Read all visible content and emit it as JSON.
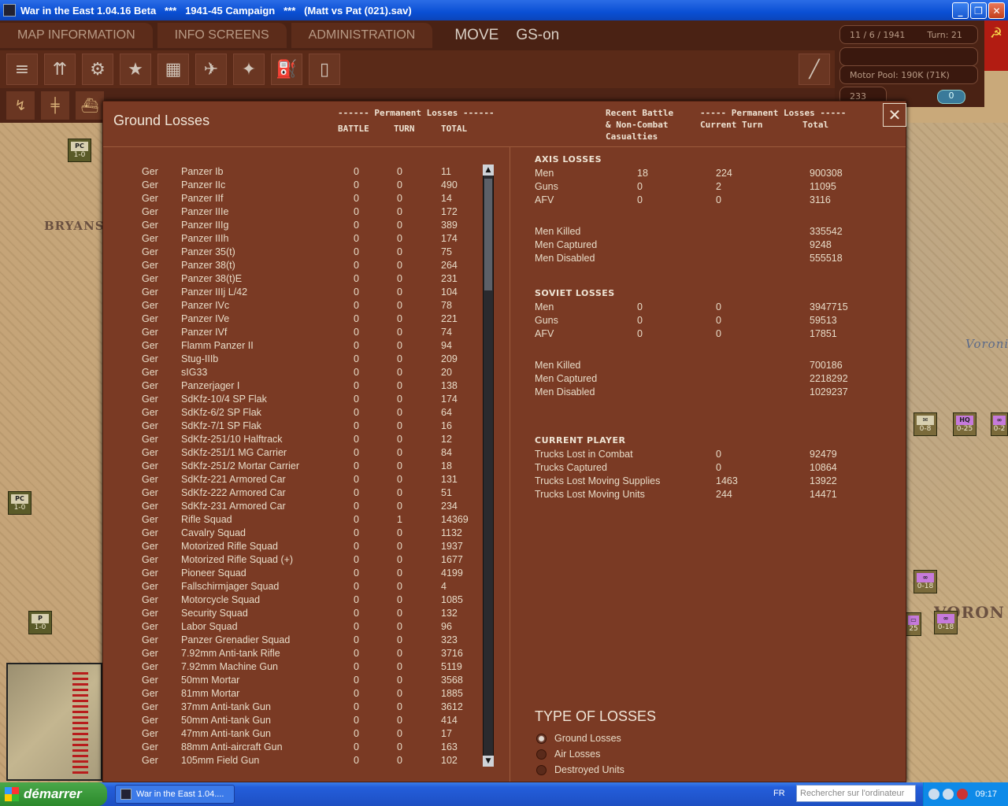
{
  "window": {
    "title": "War in the East 1.04.16 Beta",
    "sep1": "   ***   ",
    "campaign": "1941-45 Campaign",
    "sep2": "   ***   ",
    "save": "(Matt vs Pat (021).sav)",
    "min": "_",
    "max": "❐",
    "close": "✕"
  },
  "menu": {
    "tabs": [
      "MAP INFORMATION",
      "INFO SCREENS",
      "ADMINISTRATION"
    ],
    "mode": "MOVE",
    "gs": "GS-on"
  },
  "info": {
    "date": "11 / 6 / 1941",
    "turn": "Turn: 21",
    "motor_pool": "Motor Pool:  190K (71K)",
    "value": "233",
    "counter": "0"
  },
  "icons": {
    "toolbar": [
      "stack-icon",
      "units-icon",
      "gear-icon",
      "star-icon",
      "city-icon",
      "air-icon",
      "satellite-icon",
      "fuel-icon",
      "rail-icon"
    ],
    "toolbar2": [
      "road-icon",
      "railroad-icon",
      "ship-icon"
    ],
    "pencil": "pencil-icon",
    "flag": "hammer-sickle-icon"
  },
  "map": {
    "labels": [
      "BRYANS",
      "VORON",
      "Voroni"
    ],
    "counters": [
      {
        "type": "PC",
        "strength": "1-0"
      },
      {
        "type": "PC",
        "strength": "1-0"
      },
      {
        "type": "P",
        "strength": "1-0"
      },
      {
        "type": "✉",
        "strength": "0-8"
      },
      {
        "type": "HQ",
        "strength": "0-25"
      },
      {
        "type": "∞",
        "strength": "0-2"
      },
      {
        "type": "∞",
        "strength": "0-18"
      },
      {
        "type": "∞",
        "strength": "0-18"
      },
      {
        "type": "▭",
        "strength": "25"
      }
    ]
  },
  "dialog": {
    "title": "Ground Losses",
    "left_header_group": "------ Permanent Losses ------",
    "col_battle": "BATTLE",
    "col_turn": "TURN",
    "col_total": "TOTAL",
    "recent_line1": "Recent Battle",
    "recent_line2": "& Non-Combat",
    "recent_line3": "Casualties",
    "right_header_group": "----- Permanent Losses -----",
    "col_current": "Current Turn",
    "col_total2": "Total",
    "close": "✕",
    "rows": [
      [
        "Ger",
        "Panzer Ib",
        "0",
        "0",
        "11"
      ],
      [
        "Ger",
        "Panzer IIc",
        "0",
        "0",
        "490"
      ],
      [
        "Ger",
        "Panzer IIf",
        "0",
        "0",
        "14"
      ],
      [
        "Ger",
        "Panzer IIIe",
        "0",
        "0",
        "172"
      ],
      [
        "Ger",
        "Panzer IIIg",
        "0",
        "0",
        "389"
      ],
      [
        "Ger",
        "Panzer IIIh",
        "0",
        "0",
        "174"
      ],
      [
        "Ger",
        "Panzer 35(t)",
        "0",
        "0",
        "75"
      ],
      [
        "Ger",
        "Panzer 38(t)",
        "0",
        "0",
        "264"
      ],
      [
        "Ger",
        "Panzer 38(t)E",
        "0",
        "0",
        "231"
      ],
      [
        "Ger",
        "Panzer IIIj L/42",
        "0",
        "0",
        "104"
      ],
      [
        "Ger",
        "Panzer IVc",
        "0",
        "0",
        "78"
      ],
      [
        "Ger",
        "Panzer IVe",
        "0",
        "0",
        "221"
      ],
      [
        "Ger",
        "Panzer IVf",
        "0",
        "0",
        "74"
      ],
      [
        "Ger",
        "Flamm Panzer II",
        "0",
        "0",
        "94"
      ],
      [
        "Ger",
        "Stug-IIIb",
        "0",
        "0",
        "209"
      ],
      [
        "Ger",
        "sIG33",
        "0",
        "0",
        "20"
      ],
      [
        "Ger",
        "Panzerjager I",
        "0",
        "0",
        "138"
      ],
      [
        "Ger",
        "SdKfz-10/4 SP Flak",
        "0",
        "0",
        "174"
      ],
      [
        "Ger",
        "SdKfz-6/2 SP Flak",
        "0",
        "0",
        "64"
      ],
      [
        "Ger",
        "SdKfz-7/1 SP Flak",
        "0",
        "0",
        "16"
      ],
      [
        "Ger",
        "SdKfz-251/10 Halftrack",
        "0",
        "0",
        "12"
      ],
      [
        "Ger",
        "SdKfz-251/1 MG Carrier",
        "0",
        "0",
        "84"
      ],
      [
        "Ger",
        "SdKfz-251/2 Mortar Carrier",
        "0",
        "0",
        "18"
      ],
      [
        "Ger",
        "SdKfz-221 Armored Car",
        "0",
        "0",
        "131"
      ],
      [
        "Ger",
        "SdKfz-222 Armored Car",
        "0",
        "0",
        "51"
      ],
      [
        "Ger",
        "SdKfz-231 Armored Car",
        "0",
        "0",
        "234"
      ],
      [
        "Ger",
        "Rifle Squad",
        "0",
        "1",
        "14369"
      ],
      [
        "Ger",
        "Cavalry Squad",
        "0",
        "0",
        "1132"
      ],
      [
        "Ger",
        "Motorized Rifle Squad",
        "0",
        "0",
        "1937"
      ],
      [
        "Ger",
        "Motorized Rifle Squad (+)",
        "0",
        "0",
        "1677"
      ],
      [
        "Ger",
        "Pioneer Squad",
        "0",
        "0",
        "4199"
      ],
      [
        "Ger",
        "Fallschirmjager Squad",
        "0",
        "0",
        "4"
      ],
      [
        "Ger",
        "Motorcycle Squad",
        "0",
        "0",
        "1085"
      ],
      [
        "Ger",
        "Security Squad",
        "0",
        "0",
        "132"
      ],
      [
        "Ger",
        "Labor Squad",
        "0",
        "0",
        "96"
      ],
      [
        "Ger",
        "Panzer Grenadier Squad",
        "0",
        "0",
        "323"
      ],
      [
        "Ger",
        "7.92mm Anti-tank Rifle",
        "0",
        "0",
        "3716"
      ],
      [
        "Ger",
        "7.92mm Machine Gun",
        "0",
        "0",
        "5119"
      ],
      [
        "Ger",
        "50mm Mortar",
        "0",
        "0",
        "3568"
      ],
      [
        "Ger",
        "81mm Mortar",
        "0",
        "0",
        "1885"
      ],
      [
        "Ger",
        "37mm Anti-tank Gun",
        "0",
        "0",
        "3612"
      ],
      [
        "Ger",
        "50mm Anti-tank Gun",
        "0",
        "0",
        "414"
      ],
      [
        "Ger",
        "47mm Anti-tank Gun",
        "0",
        "0",
        "17"
      ],
      [
        "Ger",
        "88mm Anti-aircraft Gun",
        "0",
        "0",
        "163"
      ],
      [
        "Ger",
        "105mm Field Gun",
        "0",
        "0",
        "102"
      ]
    ],
    "scroll_up": "▲",
    "scroll_down": "▼",
    "axis": {
      "title": "AXIS LOSSES",
      "rows": [
        [
          "Men",
          "18",
          "224",
          "900308"
        ],
        [
          "Guns",
          "0",
          "2",
          "11095"
        ],
        [
          "AFV",
          "0",
          "0",
          "3116"
        ]
      ],
      "detail": [
        [
          "Men Killed",
          "335542"
        ],
        [
          "Men Captured",
          "9248"
        ],
        [
          "Men Disabled",
          "555518"
        ]
      ]
    },
    "soviet": {
      "title": "SOVIET LOSSES",
      "rows": [
        [
          "Men",
          "0",
          "0",
          "3947715"
        ],
        [
          "Guns",
          "0",
          "0",
          "59513"
        ],
        [
          "AFV",
          "0",
          "0",
          "17851"
        ]
      ],
      "detail": [
        [
          "Men Killed",
          "700186"
        ],
        [
          "Men Captured",
          "2218292"
        ],
        [
          "Men Disabled",
          "1029237"
        ]
      ]
    },
    "player": {
      "title": "CURRENT PLAYER",
      "rows": [
        [
          "Trucks Lost in Combat",
          "0",
          "92479"
        ],
        [
          "Trucks Captured",
          "0",
          "10864"
        ],
        [
          "Trucks Lost Moving Supplies",
          "1463",
          "13922"
        ],
        [
          "Trucks Lost Moving Units",
          "244",
          "14471"
        ]
      ]
    },
    "type_title": "TYPE OF LOSSES",
    "types": [
      "Ground Losses",
      "Air Losses",
      "Destroyed Units"
    ]
  },
  "taskbar": {
    "start": "démarrer",
    "task": "War in the East 1.04....",
    "lang": "FR",
    "search_placeholder": "Rechercher sur l'ordinateur",
    "clock": "09:17"
  }
}
